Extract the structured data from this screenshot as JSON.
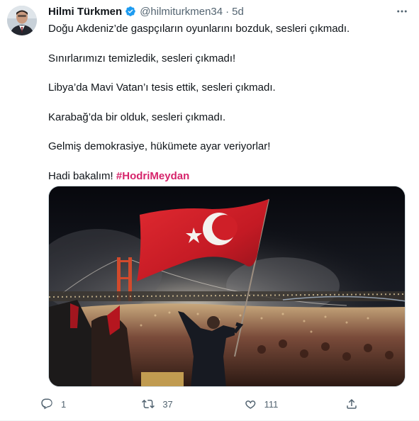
{
  "tweet": {
    "author_name": "Hilmi Türkmen",
    "handle": "@hilmiturkmen34",
    "separator": "·",
    "time": "5d",
    "lines": [
      "Doğu Akdeniz’de gaspçıların oyunlarını bozduk, sesleri çıkmadı.",
      "Sınırlarımızı temizledik, sesleri çıkmadı!",
      "Libya’da Mavi Vatan’ı tesis ettik, sesleri çıkmadı.",
      "Karabağ’da bir olduk, sesleri çıkmadı.",
      "Gelmiş demokrasiye, hükümete ayar veriyorlar!"
    ],
    "last_line_text": "Hadi bakalım!",
    "hashtag": "#HodriMeydan"
  },
  "actions": {
    "reply_count": "1",
    "retweet_count": "37",
    "like_count": "111"
  },
  "colors": {
    "verified": "#1d9bf0",
    "hashtag": "#d6246b",
    "secondary_text": "#536471",
    "flag_red": "#d4202a"
  },
  "icons": {
    "verified": "verified-badge-icon",
    "more": "more-options-icon",
    "reply": "reply-icon",
    "retweet": "retweet-icon",
    "like": "heart-icon",
    "share": "share-icon"
  }
}
